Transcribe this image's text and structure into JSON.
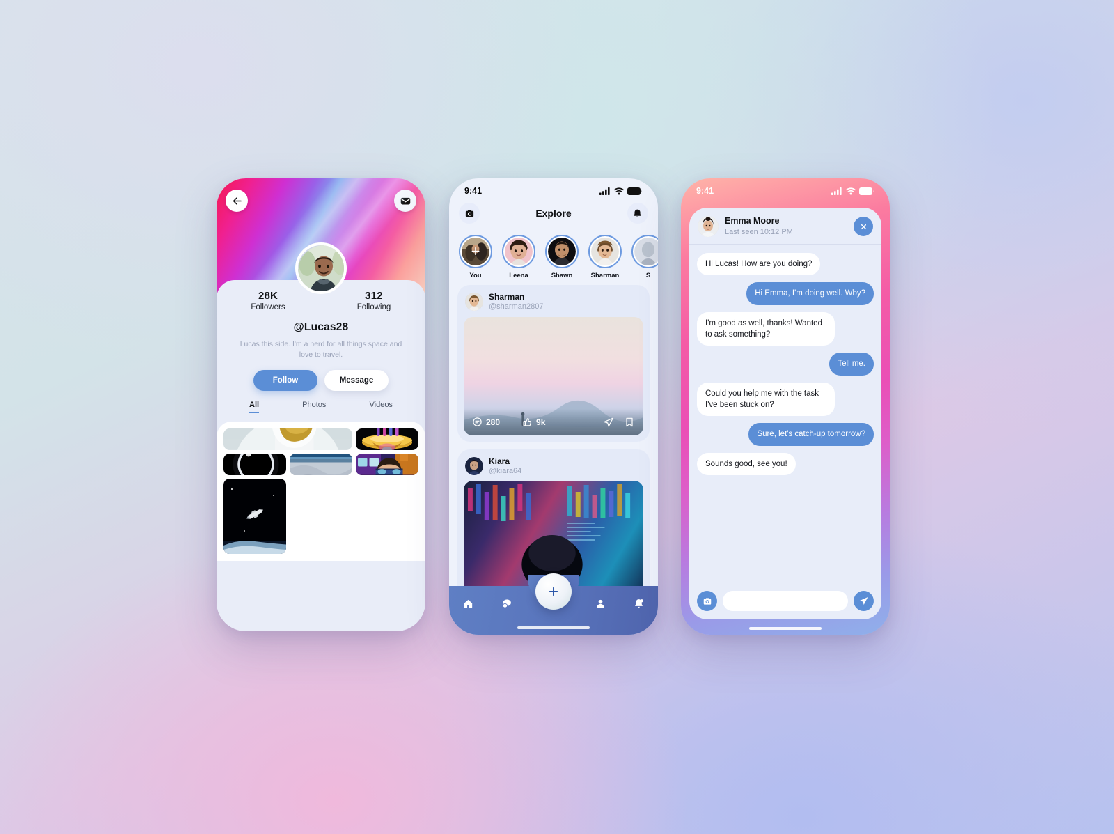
{
  "profile_screen": {
    "back_icon": "arrow-left-icon",
    "mail_icon": "envelope-icon",
    "followers": {
      "value": "28K",
      "label": "Followers"
    },
    "following": {
      "value": "312",
      "label": "Following"
    },
    "handle": "@Lucas28",
    "bio": "Lucas this side. I'm a nerd for all things space and love to travel.",
    "follow_label": "Follow",
    "message_label": "Message",
    "tabs": [
      {
        "label": "All",
        "active": true
      },
      {
        "label": "Photos",
        "active": false
      },
      {
        "label": "Videos",
        "active": false
      }
    ],
    "grid": [
      {
        "name": "astronaut-snow-photo"
      },
      {
        "name": "gold-ufo-photo"
      },
      {
        "name": "solar-eclipse-photo"
      },
      {
        "name": "earth-from-space-photo"
      },
      {
        "name": "vr-headset-kid-photo"
      },
      {
        "name": "space-shuttle-photo"
      }
    ]
  },
  "explore_screen": {
    "status_time": "9:41",
    "camera_icon": "camera-icon",
    "title": "Explore",
    "bell_icon": "bell-icon",
    "stories": [
      {
        "name": "You",
        "is_self": true
      },
      {
        "name": "Leena",
        "is_self": false
      },
      {
        "name": "Shawn",
        "is_self": false
      },
      {
        "name": "Sharman",
        "is_self": false
      },
      {
        "name": "S",
        "is_self": false
      }
    ],
    "posts": [
      {
        "name": "Sharman",
        "handle": "@sharman2807",
        "comments": "280",
        "likes": "9k",
        "image": "desert-sunset-hiker-photo"
      },
      {
        "name": "Kiara",
        "handle": "@kiara64",
        "comments": "",
        "likes": "",
        "image": "neon-city-lights-photo"
      }
    ],
    "nav": [
      {
        "name": "home-icon",
        "label": "Home"
      },
      {
        "name": "chat-icon",
        "label": "Chat"
      },
      {
        "name": "plus-icon",
        "label": "Create"
      },
      {
        "name": "person-icon",
        "label": "Profile"
      },
      {
        "name": "bell-icon",
        "label": "Notifications"
      }
    ]
  },
  "chat_screen": {
    "status_time": "9:41",
    "contact_name": "Emma Moore",
    "last_seen": "Last seen 10:12 PM",
    "close_icon": "close-icon",
    "messages": [
      {
        "text": "Hi Lucas! How are you doing?",
        "side": "in"
      },
      {
        "text": "Hi Emma, I'm doing well. Wby?",
        "side": "out"
      },
      {
        "text": "I'm good as well, thanks! Wanted to ask something?",
        "side": "in"
      },
      {
        "text": "Tell me.",
        "side": "out"
      },
      {
        "text": "Could you help me with the task I've been stuck on?",
        "side": "in"
      },
      {
        "text": "Sure, let's catch-up tomorrow?",
        "side": "out"
      },
      {
        "text": "Sounds good, see you!",
        "side": "in"
      }
    ],
    "input_placeholder": "",
    "input_value": "",
    "camera_icon": "camera-icon",
    "send_icon": "send-icon"
  },
  "colors": {
    "accent_blue": "#5b8ed6",
    "bubble_in": "#ffffff",
    "panel": "#e8edf9",
    "text_dark": "#101215",
    "text_muted": "#9aa3b8"
  }
}
